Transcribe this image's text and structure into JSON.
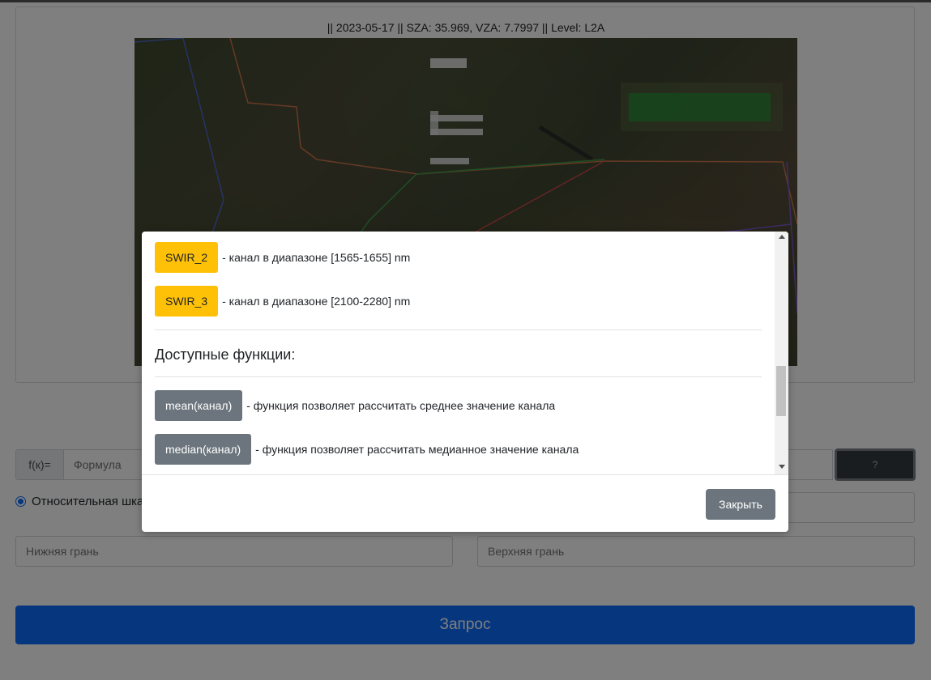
{
  "image_panel": {
    "title": "|| 2023-05-17 || SZA: 35.969, VZA: 7.7997 || Level: L2A"
  },
  "formula": {
    "prefix": "f(к)=",
    "placeholder": "Формула",
    "help_label": "?"
  },
  "scale": {
    "relative_label": "Относительная шкала",
    "selected": true
  },
  "bounds": {
    "lower_placeholder": "Нижняя грань",
    "upper_placeholder": "Верхняя грань"
  },
  "submit": {
    "label": "Запрос"
  },
  "modal": {
    "bands": [
      {
        "name": "SWIR_2",
        "desc": "- канал в диапазоне [1565-1655] nm"
      },
      {
        "name": "SWIR_3",
        "desc": "- канал в диапазоне [2100-2280] nm"
      }
    ],
    "functions_title": "Доступные функции:",
    "functions": [
      {
        "name": "mean(канал)",
        "desc": "- функция позволяет рассчитать среднее значение канала"
      },
      {
        "name": "median(канал)",
        "desc": "- функция позволяет рассчитать медианное значение канала"
      }
    ],
    "close_label": "Закрыть"
  },
  "colors": {
    "band_badge": "#ffc107",
    "func_badge": "#6c757d",
    "primary": "#0d6efd",
    "overlay": "rgba(0,0,0,0.5)"
  }
}
